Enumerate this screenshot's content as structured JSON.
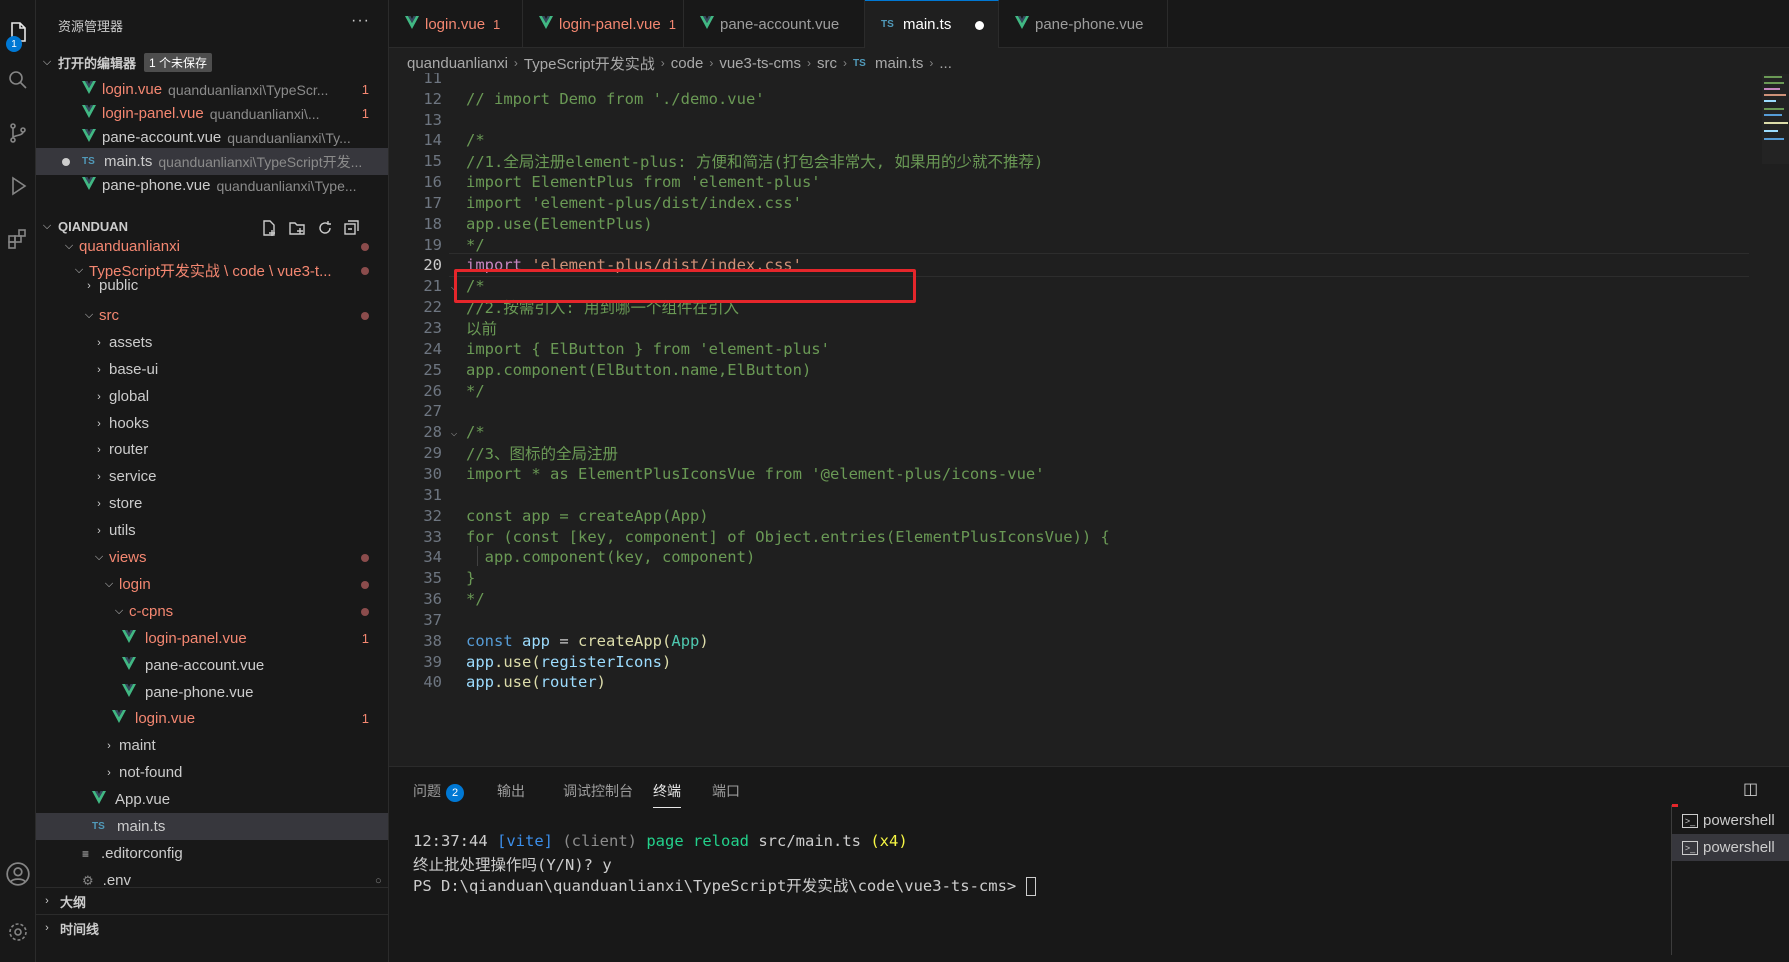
{
  "activity": {
    "explorer_badge": "1"
  },
  "sidebar": {
    "title": "资源管理器",
    "more": "···",
    "open_editors": {
      "label": "打开的编辑器",
      "unsaved": "1 个未保存",
      "items": [
        {
          "name": "login.vue",
          "path": "quanduanlianxi\\TypeScr...",
          "count": "1",
          "error": true
        },
        {
          "name": "login-panel.vue",
          "path": "quanduanlianxi\\...",
          "count": "1",
          "error": true
        },
        {
          "name": "pane-account.vue",
          "path": "quanduanlianxi\\Ty...",
          "count": "",
          "error": false
        },
        {
          "name": "main.ts",
          "path": "quanduanlianxi\\TypeScript开发...",
          "count": "",
          "error": false
        },
        {
          "name": "pane-phone.vue",
          "path": "quanduanlianxi\\Type...",
          "count": "",
          "error": false
        }
      ]
    },
    "workspace": {
      "label": "QIANDUAN",
      "tree": [
        {
          "name": "quanduanlianxi",
          "kind": "folder-open",
          "depth": 1,
          "red": true,
          "dot": true
        },
        {
          "name": "TypeScript开发实战 \\ code \\ vue3-t...",
          "kind": "folder-open",
          "depth": 2,
          "red": true,
          "dot": true
        },
        {
          "name": "public",
          "kind": "folder",
          "depth": 3,
          "red": false,
          "dot": false
        },
        {
          "name": "src",
          "kind": "folder-open",
          "depth": 3,
          "red": true,
          "dot": true
        },
        {
          "name": "assets",
          "kind": "folder",
          "depth": 4
        },
        {
          "name": "base-ui",
          "kind": "folder",
          "depth": 4
        },
        {
          "name": "global",
          "kind": "folder",
          "depth": 4
        },
        {
          "name": "hooks",
          "kind": "folder",
          "depth": 4
        },
        {
          "name": "router",
          "kind": "folder",
          "depth": 4
        },
        {
          "name": "service",
          "kind": "folder",
          "depth": 4
        },
        {
          "name": "store",
          "kind": "folder",
          "depth": 4
        },
        {
          "name": "utils",
          "kind": "folder",
          "depth": 4
        },
        {
          "name": "views",
          "kind": "folder-open",
          "depth": 4,
          "red": true,
          "dot": true
        },
        {
          "name": "login",
          "kind": "folder-open",
          "depth": 5,
          "red": true,
          "dot": true
        },
        {
          "name": "c-cpns",
          "kind": "folder-open",
          "depth": 6,
          "red": true,
          "dot": true
        },
        {
          "name": "login-panel.vue",
          "kind": "vue",
          "depth": 7,
          "red": true,
          "count": "1"
        },
        {
          "name": "pane-account.vue",
          "kind": "vue",
          "depth": 7
        },
        {
          "name": "pane-phone.vue",
          "kind": "vue",
          "depth": 7
        },
        {
          "name": "login.vue",
          "kind": "vue",
          "depth": 6,
          "red": true,
          "count": "1"
        },
        {
          "name": "maint",
          "kind": "folder",
          "depth": 5
        },
        {
          "name": "not-found",
          "kind": "folder",
          "depth": 5
        },
        {
          "name": "App.vue",
          "kind": "vue",
          "depth": 4
        },
        {
          "name": "main.ts",
          "kind": "ts",
          "depth": 4
        },
        {
          "name": ".editorconfig",
          "kind": "lines",
          "depth": 3
        },
        {
          "name": ".env",
          "kind": "gear",
          "depth": 3
        }
      ]
    },
    "outline_label": "大纲",
    "timeline_label": "时间线"
  },
  "tabs": [
    {
      "name": "login.vue",
      "count": "1",
      "error": true,
      "icon": "vue-icon"
    },
    {
      "name": "login-panel.vue",
      "count": "1",
      "error": true,
      "icon": "vue-icon"
    },
    {
      "name": "pane-account.vue",
      "count": "",
      "error": false,
      "icon": "vue-icon"
    },
    {
      "name": "main.ts",
      "count": "",
      "error": false,
      "icon": "ts-icon",
      "active": true,
      "modified": true
    },
    {
      "name": "pane-phone.vue",
      "count": "",
      "error": false,
      "icon": "vue-icon"
    }
  ],
  "breadcrumb": [
    "quanduanlianxi",
    "TypeScript开发实战",
    "code",
    "vue3-ts-cms",
    "src",
    "main.ts",
    "..."
  ],
  "editor": {
    "current_line": "20",
    "lines": [
      {
        "n": "11",
        "text": ""
      },
      {
        "n": "12",
        "text": "// import Demo from './demo.vue'"
      },
      {
        "n": "13",
        "text": ""
      },
      {
        "n": "14",
        "text": "/*"
      },
      {
        "n": "15",
        "text": "//1.全局注册element-plus: 方便和简洁(打包会非常大, 如果用的少就不推荐)"
      },
      {
        "n": "16",
        "text": "import ElementPlus from 'element-plus'"
      },
      {
        "n": "17",
        "text": "import 'element-plus/dist/index.css'"
      },
      {
        "n": "18",
        "text": "app.use(ElementPlus)"
      },
      {
        "n": "19",
        "text": "*/"
      },
      {
        "n": "20",
        "text": "import 'element-plus/dist/index.css'"
      },
      {
        "n": "21",
        "text": "/*"
      },
      {
        "n": "22",
        "text": "//2.按需引入: 用到哪一个组件在引入"
      },
      {
        "n": "23",
        "text": "以前"
      },
      {
        "n": "24",
        "text": "import { ElButton } from 'element-plus'"
      },
      {
        "n": "25",
        "text": "app.component(ElButton.name,ElButton)"
      },
      {
        "n": "26",
        "text": "*/"
      },
      {
        "n": "27",
        "text": ""
      },
      {
        "n": "28",
        "text": "/*"
      },
      {
        "n": "29",
        "text": "//3、图标的全局注册"
      },
      {
        "n": "30",
        "text": "import * as ElementPlusIconsVue from '@element-plus/icons-vue'"
      },
      {
        "n": "31",
        "text": ""
      },
      {
        "n": "32",
        "text": "const app = createApp(App)"
      },
      {
        "n": "33",
        "text": "for (const [key, component] of Object.entries(ElementPlusIconsVue)) {"
      },
      {
        "n": "34",
        "text": "  app.component(key, component)"
      },
      {
        "n": "35",
        "text": "}"
      },
      {
        "n": "36",
        "text": "*/"
      },
      {
        "n": "37",
        "text": ""
      },
      {
        "n": "38",
        "text": "const app = createApp(App)"
      },
      {
        "n": "39",
        "text": "app.use(registerIcons)"
      },
      {
        "n": "40",
        "text": "app.use(router)"
      }
    ],
    "code20": {
      "kw": "import",
      "str": "'element-plus/dist/index.css'"
    },
    "code38": {
      "kw": "const",
      "v": "app",
      "op": " = ",
      "fn": "createApp",
      "arg": "App"
    },
    "code39": {
      "v": "app",
      "fn": ".use",
      "arg": "registerIcons"
    },
    "code40": {
      "v": "app",
      "fn": ".use",
      "arg": "router"
    }
  },
  "panel": {
    "tabs": [
      {
        "label": "问题",
        "badge": "2"
      },
      {
        "label": "输出"
      },
      {
        "label": "调试控制台"
      },
      {
        "label": "终端",
        "active": true
      },
      {
        "label": "端口"
      }
    ],
    "terminal": {
      "l1_time": "12:37:44",
      "l1_vite": "[vite]",
      "l1_client": "(client)",
      "l1_msg": "page reload",
      "l1_file": "src/main.ts",
      "l1_count": "(x4)",
      "l2": "终止批处理操作吗(Y/N)? y",
      "l3": "PS D:\\qianduan\\quanduanlianxi\\TypeScript开发实战\\code\\vue3-ts-cms>"
    },
    "term_list": [
      "powershell",
      "powershell"
    ]
  },
  "colors": {
    "accent": "#0078d4",
    "highlight_box": "#e5262b",
    "error_text": "#f48771"
  }
}
